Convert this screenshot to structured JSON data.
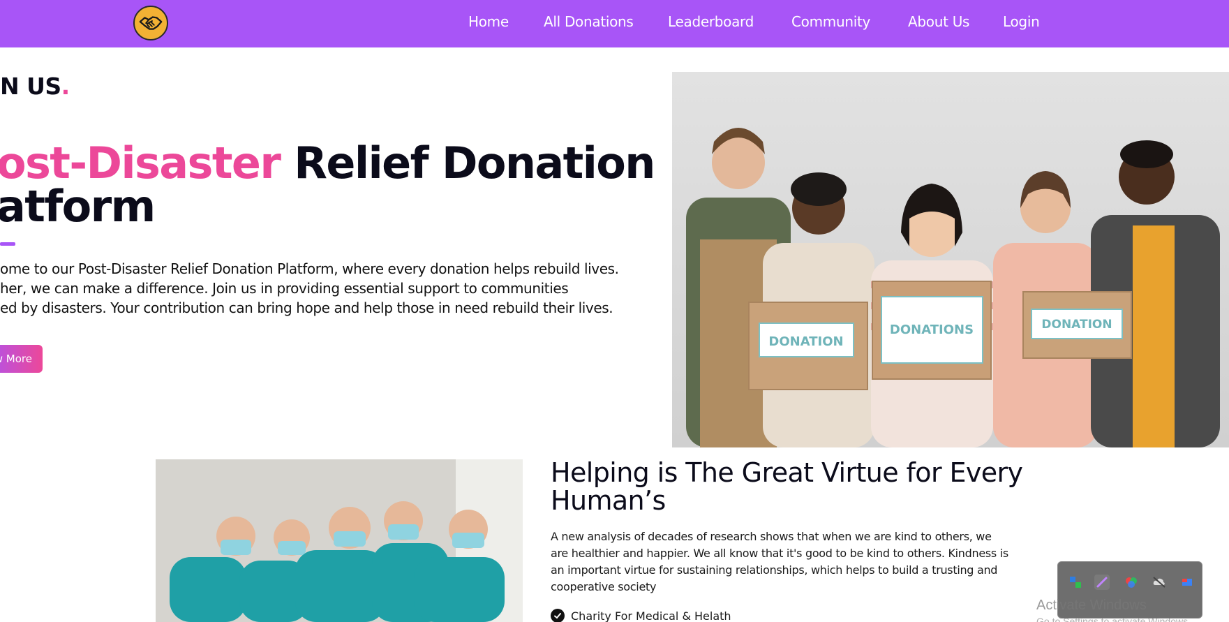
{
  "nav": {
    "logo": "handshake-logo",
    "links": [
      "Home",
      "All Donations",
      "Leaderboard",
      "Community",
      "About Us",
      "Login"
    ]
  },
  "hero": {
    "eyebrow": "N US",
    "eyebrow_dot": ".",
    "title_accent": "ost-Disaster",
    "title_rest": " Relief Donation",
    "title_line2": "atform",
    "desc_lines": [
      "ome to our Post-Disaster Relief Donation Platform, where every donation helps rebuild lives.",
      "her, we can make a difference. Join us in providing essential support to communities",
      "ed by disasters. Your contribution can bring hope and help those in need rebuild their lives."
    ],
    "button": "ow More",
    "photo_labels": [
      "DONATION",
      "DONATIONS",
      "DONATION"
    ]
  },
  "section2": {
    "title": "Helping is The Great Virtue for Every Human’s",
    "desc": "A new analysis of decades of research shows that when we are kind to others, we are healthier and happier. We all know that it's good to be kind to others. Kindness is an important virtue for sustaining relationships, which helps to build a trusting and cooperative society",
    "checklist": [
      "Charity For Medical & Helath"
    ]
  },
  "os": {
    "watermark": "Activate Windows",
    "watermark_sub": "Go to Settings to activate Windows."
  },
  "colors": {
    "nav_bg": "#a855f7",
    "accent_pink": "#ec4899",
    "heading": "#0b0b1a"
  }
}
